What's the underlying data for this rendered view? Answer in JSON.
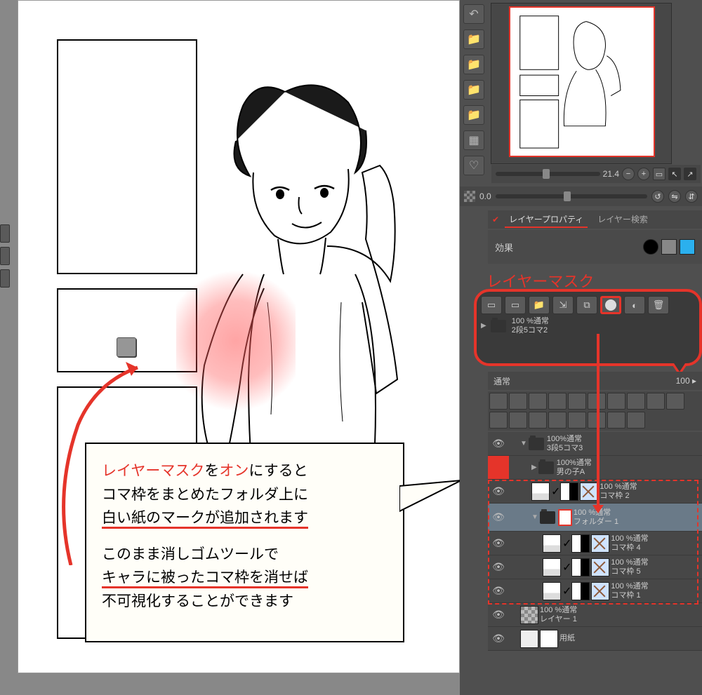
{
  "navigator": {
    "zoom": "21.4"
  },
  "brush": {
    "size": "0.0"
  },
  "palette_tabs": {
    "layer_property": "レイヤープロパティ",
    "layer_search": "レイヤー検索"
  },
  "effect": {
    "label": "効果"
  },
  "annotation": {
    "layer_mask_label": "レイヤーマスク"
  },
  "mask_callout": {
    "opacity_line1": "100 %通常",
    "opacity_line2": "2段5コマ2"
  },
  "layer_panel": {
    "blend_mode": "通常",
    "opacity": "100"
  },
  "layers": {
    "l1": {
      "mode": "100%通常",
      "name": "3段5コマ3"
    },
    "l2": {
      "mode": "100%通常",
      "name": "男の子A"
    },
    "l3": {
      "mode": "100 %通常",
      "name": "コマ枠 2"
    },
    "l4": {
      "mode": "100 %通常",
      "name": "フォルダー 1"
    },
    "l5": {
      "mode": "100 %通常",
      "name": "コマ枠 4"
    },
    "l6": {
      "mode": "100 %通常",
      "name": "コマ枠 5"
    },
    "l7": {
      "mode": "100 %通常",
      "name": "コマ枠 1"
    },
    "l8": {
      "mode": "100 %通常",
      "name": "レイヤー 1"
    },
    "l9": {
      "name": "用紙"
    }
  },
  "note": {
    "s1a": "レイヤーマスク",
    "s1b": "を",
    "s1c": "オン",
    "s1d": "にすると",
    "s2": "コマ枠をまとめたフォルダ上に",
    "s3": "白い紙のマークが追加されます",
    "s4": "このまま消しゴムツールで",
    "s5": "キャラに被ったコマ枠を消せば",
    "s6": "不可視化することができます"
  }
}
